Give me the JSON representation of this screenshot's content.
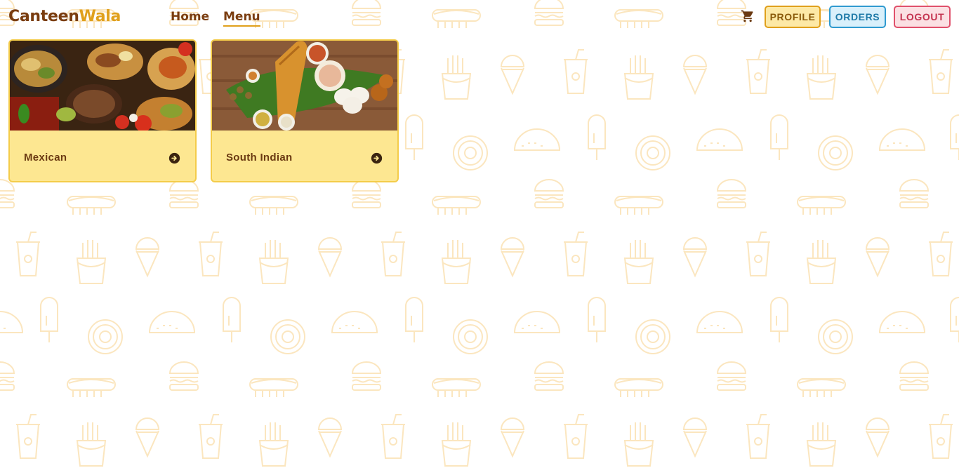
{
  "app": {
    "brand_part1": "Canteen",
    "brand_part2": "Wala"
  },
  "nav": {
    "home_label": "Home",
    "menu_label": "Menu",
    "active": "Menu"
  },
  "actions": {
    "cart_icon": "cart-icon",
    "profile_label": "PROFILE",
    "orders_label": "ORDERS",
    "logout_label": "LOGOUT"
  },
  "menu": {
    "categories": [
      {
        "label": "Mexican",
        "icon": "arrow-circle-right-icon"
      },
      {
        "label": "South Indian",
        "icon": "arrow-circle-right-icon"
      }
    ]
  },
  "colors": {
    "brand_dark": "#7a3d10",
    "brand_accent": "#e0a01c",
    "card_bg": "#fde791",
    "card_border": "#f4cc4a",
    "pattern": "#fbe8c2"
  }
}
